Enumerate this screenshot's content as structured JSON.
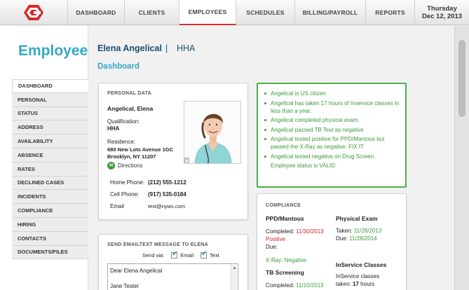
{
  "nav": {
    "items": [
      {
        "label": "DASHBOARD",
        "active": false
      },
      {
        "label": "CLIENTS",
        "active": false
      },
      {
        "label": "EMPLOYEES",
        "active": true
      },
      {
        "label": "SCHEDULES",
        "active": false
      },
      {
        "label": "BILLING/PAYROLL",
        "active": false
      },
      {
        "label": "REPORTS",
        "active": false
      }
    ],
    "day": "Thursday",
    "date": "Dec 12, 2013",
    "brand_color": "#d52b2b"
  },
  "sidebar": {
    "title": "Employee",
    "items": [
      {
        "label": "DASHBOARD",
        "active": true
      },
      {
        "label": "PERSONAL"
      },
      {
        "label": "STATUS"
      },
      {
        "label": "ADDRESS"
      },
      {
        "label": "AVAILABILITY"
      },
      {
        "label": "ABSENCE"
      },
      {
        "label": "RATES"
      },
      {
        "label": "DECLINED CASES"
      },
      {
        "label": "INCIDENTS"
      },
      {
        "label": "COMPLIANCE"
      },
      {
        "label": "HIRING"
      },
      {
        "label": "CONTACTS"
      },
      {
        "label": "DOCUMENTS/FILES"
      }
    ]
  },
  "header": {
    "name": "Elena Angelical",
    "separator": "|",
    "role": "HHA",
    "section": "Dashboard"
  },
  "personal": {
    "title": "PERSONAL DATA",
    "name": "Angelical, Elena",
    "qualification_label": "Qualification:",
    "qualification": "HHA",
    "residence_label": "Residence:",
    "address_line1": "680 New Lots Avenue 1GC",
    "address_line2": "Brooklyn, NY 11207",
    "directions_icon": "H",
    "directions": "Directions",
    "home_phone_label": "Home Phone:",
    "home_phone": "(212) 555-1212",
    "cell_phone_label": "Cell Phone:",
    "cell_phone": "(917) 535-0184",
    "email_label": "Email",
    "email": "test@nyws.com"
  },
  "status": {
    "lines": [
      {
        "text": "Angelical is US citizen",
        "bullet": true
      },
      {
        "text": "Angelical has taken 17 hours of Inservice classes in less than a year.",
        "bullet": true
      },
      {
        "text": "Angelical completed physical exam.",
        "bullet": true
      },
      {
        "text": "Angelical passed TB Test as negative",
        "bullet": true
      },
      {
        "text": "Angelical tested positive for PPD/Mantoux but passed the X-Ray as negative. FIX IT",
        "bullet": true
      },
      {
        "text": "Angelical tested negative on Drug Screen.",
        "bullet": true
      },
      {
        "text": "Employee status is VALID.",
        "bullet": false
      }
    ],
    "color": "#3a9a3a"
  },
  "send": {
    "title": "SEND EMAILTEXT MESSAGE TO ELENA",
    "via_label": "Send via:",
    "email_option": "Email",
    "text_option": "Text",
    "message_line1": "Dear Elena Angelical",
    "message_line2": "Jane Tester"
  },
  "compliance": {
    "title": "COMPLIANCE",
    "ppd_head": "PPD/Mantoux",
    "ppd_completed_label": "Completed:",
    "ppd_completed": "11/30/2013",
    "ppd_result": "Positive",
    "ppd_due_label": "Due:",
    "xray": "X-Ray: Negative",
    "tb_head": "TB Screening",
    "tb_completed_label": "Completed:",
    "tb_completed": "11/10/2013",
    "phys_head": "Physical Exam",
    "phys_taken_label": "Taken:",
    "phys_taken": "11/28/2013",
    "phys_due_label": "Due:",
    "phys_due": "11/28/2014",
    "inservice_head": "InService Classes",
    "inservice_line1": "InService classes",
    "inservice_taken_label": "taken:",
    "inservice_hours": "17",
    "inservice_unit": "hours"
  }
}
